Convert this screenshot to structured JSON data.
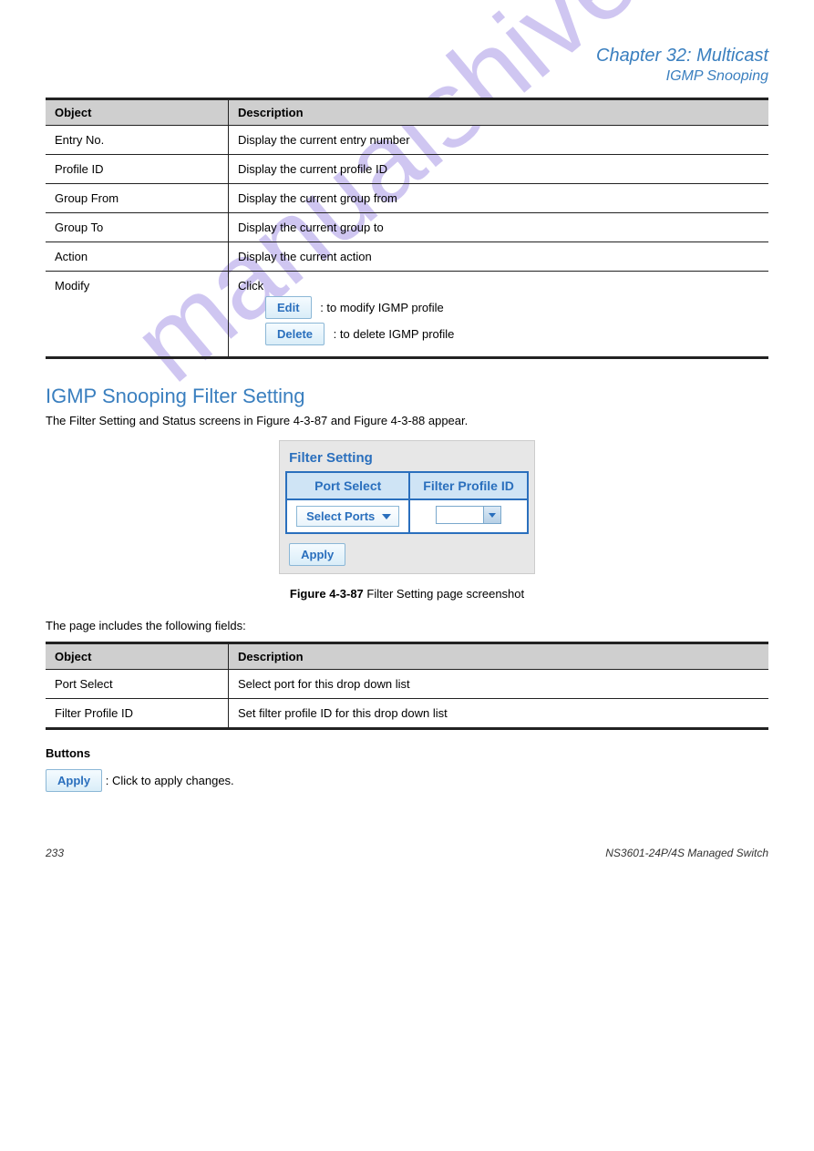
{
  "header": {
    "chapter": "32",
    "chapter_title": "Multicast",
    "subtitle": "IGMP Snooping"
  },
  "profile_table": {
    "col1_header": "Object",
    "col2_header": "Description",
    "rows": [
      {
        "object": "Entry No.",
        "desc": "Display the current entry number"
      },
      {
        "object": "Profile ID",
        "desc": "Display the current profile ID"
      },
      {
        "object": "Group From",
        "desc": "Display the current group from"
      },
      {
        "object": "Group To",
        "desc": "Display the current group to"
      },
      {
        "object": "Action",
        "desc": "Display the current action"
      }
    ],
    "modify_row": {
      "object": "Modify",
      "edit_label": "Edit",
      "edit_explain": ": to modify IGMP profile",
      "delete_label": "Delete",
      "delete_explain": ": to delete IGMP profile"
    }
  },
  "filter_section": {
    "heading": "IGMP Snooping Filter Setting",
    "intro_1": "The Filter Setting and Status screens in ",
    "fig_ref_1": "Figure 4-3-87",
    "intro_2": " and ",
    "fig_ref_2": "Figure 4-3-88",
    "intro_3": " appear.",
    "panel_title": "Filter Setting",
    "col_port": "Port Select",
    "col_profile": "Filter Profile ID",
    "select_ports_label": "Select Ports",
    "apply_label": "Apply",
    "figcap_prefix": "Figure 4-3-87",
    "figcap_rest": " Filter Setting page screenshot",
    "lead": "The page includes the following fields:"
  },
  "filter_fields_table": {
    "col1_header": "Object",
    "col2_header": "Description",
    "rows": [
      {
        "object": "Port Select",
        "desc": "Select port for this drop down list"
      },
      {
        "object": "Filter Profile ID",
        "desc": "Set filter profile ID for this drop down list"
      }
    ]
  },
  "buttons_block": {
    "heading": "Buttons",
    "apply_label": "Apply",
    "apply_desc": ": Click to apply changes."
  },
  "footer": {
    "page": "233",
    "model": "NS3601-24P/4S Managed Switch"
  },
  "watermark": "manualshive.com"
}
